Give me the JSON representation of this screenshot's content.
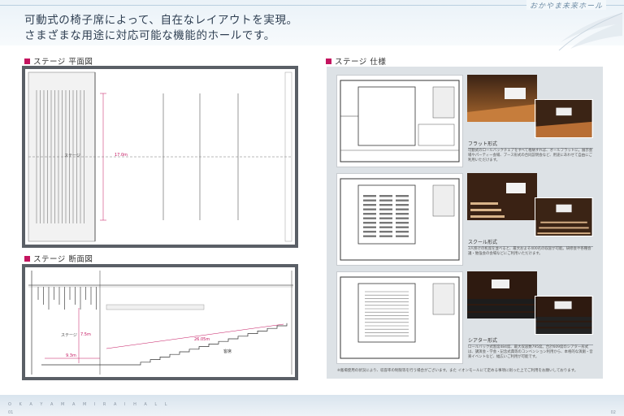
{
  "header": {
    "hall_name": "おかやま未来ホール",
    "headline_line1": "可動式の椅子席によって、自在なレイアウトを実現。",
    "headline_line2": "さまざまな用途に対応可能な機能的ホールです。"
  },
  "plan": {
    "title": "ステージ 平面図",
    "stage_label": "ステージ",
    "width_dim": "17.0m"
  },
  "section": {
    "title": "ステージ 断面図",
    "stage_label": "ステージ",
    "height_dim": "7.5m",
    "depth_dim": "9.3m",
    "span_dim": "26.05m",
    "seat_label": "客席"
  },
  "spec": {
    "title": "ステージ 仕様",
    "layouts": [
      {
        "label": "フラット形式",
        "desc": "可動式のロールバックチェアをすべて格納すれば、オールフラットに。展示会場やパーティー会場、ブース形式の合同説明会など、用途にあわせて自由にご利用いただけます。"
      },
      {
        "label": "スクール形式",
        "desc": "3人掛けの机席を並べると、最大およそ400名の収容が可能。研修会や各種会議・勉強会の会場などにご利用いただけます。"
      },
      {
        "label": "シアター形式",
        "desc": "ロールバック式客席484席、最大収容数795席。合計609席のシアター形式は、講演会・学会・記念式典等のコンベンション利用から、本格的な演劇・音楽イベントなど、幅広いご利用が可能です。"
      }
    ],
    "footnote": "※搬場使用の状況により、収容率の制限等を行う場合がございます。また イオンモールにて定める事項に則った上でご利用をお願いしております。"
  },
  "footer": {
    "brand_text": "O K A Y A M A  M I R A I  H A L L",
    "page_left": "01",
    "page_right": "02"
  },
  "colors": {
    "accent_square": "#c4145f",
    "frame": "#5a5f66",
    "panel_bg": "#dde2e6"
  }
}
